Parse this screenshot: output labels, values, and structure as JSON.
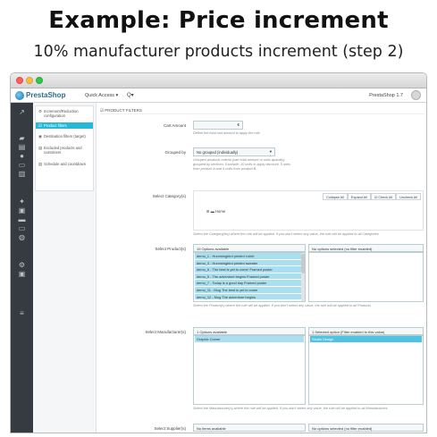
{
  "heading": {
    "title": "Example: Price increment",
    "subtitle": "10% manufacturer products increment (step 2)"
  },
  "topbar": {
    "brand": "PrestaShop",
    "quick_access": "Quick Access ▾",
    "search_icon": "Q▾",
    "version": "PrestaShop 1.7"
  },
  "subnav": {
    "tabs": [
      {
        "icon": "⚙",
        "label": "Increment/Reduction configuration"
      },
      {
        "icon": "☑",
        "label": "Product filters"
      },
      {
        "icon": "◉",
        "label": "Destination filters (target)"
      },
      {
        "icon": "▤",
        "label": "Excluded products and customers"
      },
      {
        "icon": "▤",
        "label": "Schedule and countdown"
      }
    ]
  },
  "panel": {
    "heading": "☑ PRODUCT FILTERS",
    "cart_amount_label": "Cart Amount",
    "cart_amount_value": "€",
    "cart_amount_help": "Define the total cart amount to apply the rule",
    "grouped_label": "Grouped by",
    "grouped_value": "No grouped (individually)",
    "grouped_help": "Grouped products criteria (cart total amount or units quantity) grouped by sections. Example: 10 units in apply discount, 5 units from product A and 5 units from product B.",
    "category_label": "Select Category(s)",
    "category_buttons": [
      "Collapse All",
      "Expand All",
      "☑ Check All",
      "Uncheck All"
    ],
    "category_tree_item": "⊞ ▬ Home",
    "category_help": "Select the Category(ies) where the rule will be applied. If you don't select any value, the rule will be applied to all Categories",
    "products_label": "Select Product(s)",
    "products_available": "19 Options available",
    "products_selected": "No options selected (no filter enabled)",
    "products_options": [
      "demo_1 - Hummingbird printed t-shirt",
      "demo_3 - Hummingbird printed sweater",
      "demo_6 - The best is yet to come' Framed poster",
      "demo_5 - The adventure begins Framed poster",
      "demo_7 - Today is a good day Framed poster",
      "demo_11 - Mug The best is yet to come",
      "demo_12 - Mug The adventure begins"
    ],
    "products_help": "Select the Product(s) where the rule will be applied. If you don't select any value, the rule will be applied to all Products",
    "manufacturers_label": "Select Manufacturer(s)",
    "manufacturers_available": "1 Options available",
    "manufacturers_selected": "1 Selected option (Filter enabled to this value)",
    "manufacturers_left_options": [
      "Graphic Corner"
    ],
    "manufacturers_right_options": [
      "Studio Design"
    ],
    "manufacturers_help": "Select the Manufacturer(s) where the rule will be applied. If you don't select any value, the rule will be applied to all Manufacturers",
    "suppliers_label": "Select Supplier(s)",
    "suppliers_available": "No items available",
    "suppliers_selected": "No options selected (no filter enabled)"
  },
  "colors": {
    "accent": "#25b9d7",
    "sidebar": "#363a41",
    "selected_option": "#a9dff0"
  }
}
